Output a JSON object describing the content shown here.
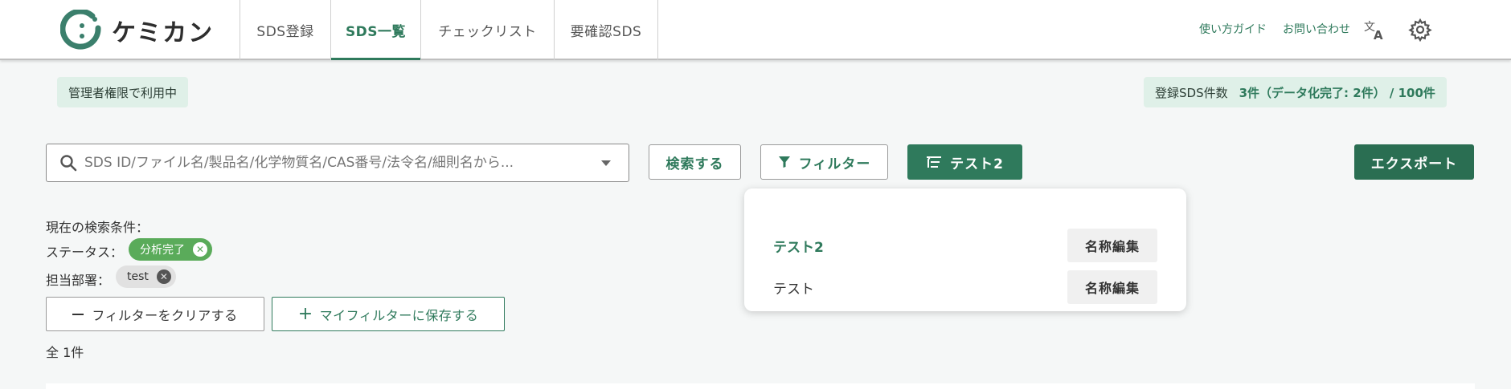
{
  "app": {
    "logo_text": "ケミカン"
  },
  "tabs": [
    {
      "label": "SDS登録"
    },
    {
      "label": "SDS一覧"
    },
    {
      "label": "チェックリスト"
    },
    {
      "label": "要確認SDS"
    }
  ],
  "header_links": {
    "guide": "使い方ガイド",
    "contact": "お問い合わせ"
  },
  "admin_badge": "管理者権限で利用中",
  "count_badge": {
    "label": "登録SDS件数",
    "value": "3件（データ化完了: 2件） / 100件"
  },
  "search": {
    "placeholder": "SDS ID/ファイル名/製品名/化学物質名/CAS番号/法令名/細則名から..."
  },
  "buttons": {
    "search": "検索する",
    "filter": "フィルター",
    "saved_filter": "テスト2",
    "export": "エクスポート",
    "clear": "フィルターをクリアする",
    "save_filter": "マイフィルターに保存する"
  },
  "conditions": {
    "title": "現在の検索条件：",
    "status_label": "ステータス：",
    "status_value": "分析完了",
    "dept_label": "担当部署：",
    "dept_value": "test"
  },
  "total": "全 1件",
  "saved_filters": [
    {
      "name": "テスト2",
      "edit": "名称編集"
    },
    {
      "name": "テスト",
      "edit": "名称編集"
    }
  ],
  "colors": {
    "accent": "#2f7a5c",
    "badge_bg": "#dff0e8",
    "status_chip": "#5aab5a"
  }
}
